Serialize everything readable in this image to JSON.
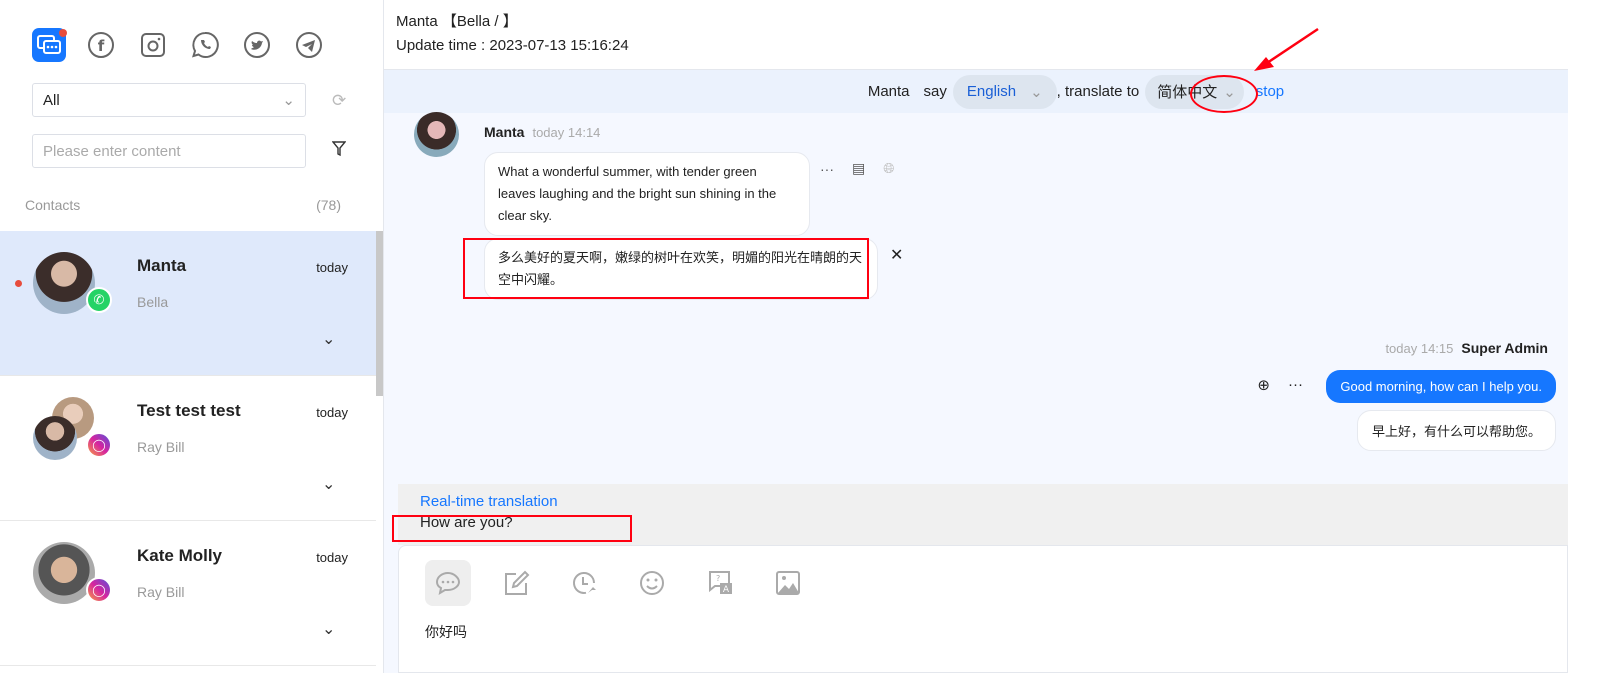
{
  "sidebar": {
    "channels": [
      {
        "icon": "chat-icon",
        "active": true
      },
      {
        "icon": "facebook-icon"
      },
      {
        "icon": "instagram-icon"
      },
      {
        "icon": "whatsapp-icon"
      },
      {
        "icon": "twitter-icon"
      },
      {
        "icon": "telegram-icon"
      }
    ],
    "filter_select": "All",
    "search_placeholder": "Please enter content",
    "contacts_label": "Contacts",
    "contacts_count": "(78)",
    "contacts": [
      {
        "name": "Manta",
        "sub": "Bella",
        "time": "today",
        "channel": "whatsapp",
        "unread": true,
        "selected": true
      },
      {
        "name": "Test test test",
        "sub": "Ray Bill",
        "time": "today",
        "channel": "instagram"
      },
      {
        "name": "Kate Molly",
        "sub": "Ray Bill",
        "time": "today",
        "channel": "instagram"
      }
    ]
  },
  "header": {
    "title": "Manta 【Bella / 】",
    "update_label": "Update time : 2023-07-13 15:16:24"
  },
  "translate_bar": {
    "speaker": "Manta",
    "say": "say",
    "source_lang": "English",
    "translate_to": ", translate to",
    "target_lang": "简体中文",
    "stop": "stop"
  },
  "messages": {
    "incoming": {
      "sender": "Manta",
      "time": "today 14:14",
      "text": "What a wonderful summer, with tender green leaves laughing and the bright sun shining in the clear sky.",
      "translation": "多么美好的夏天啊，嫩绿的树叶在欢笑，明媚的阳光在晴朗的天空中闪耀。"
    },
    "outgoing": {
      "sender": "Super Admin",
      "time": "today 14:15",
      "text": "Good morning, how can I help you.",
      "translation": "早上好，有什么可以帮助您。"
    }
  },
  "composer": {
    "rt_label": "Real-time translation",
    "rt_text": "How are you?",
    "input_text": "你好吗",
    "tools": [
      "quick-reply-icon",
      "edit-icon",
      "schedule-icon",
      "emoji-icon",
      "translate-icon",
      "image-icon"
    ]
  },
  "colors": {
    "accent": "#1677ff",
    "annotation": "#ff1100",
    "whatsapp": "#25d366"
  }
}
